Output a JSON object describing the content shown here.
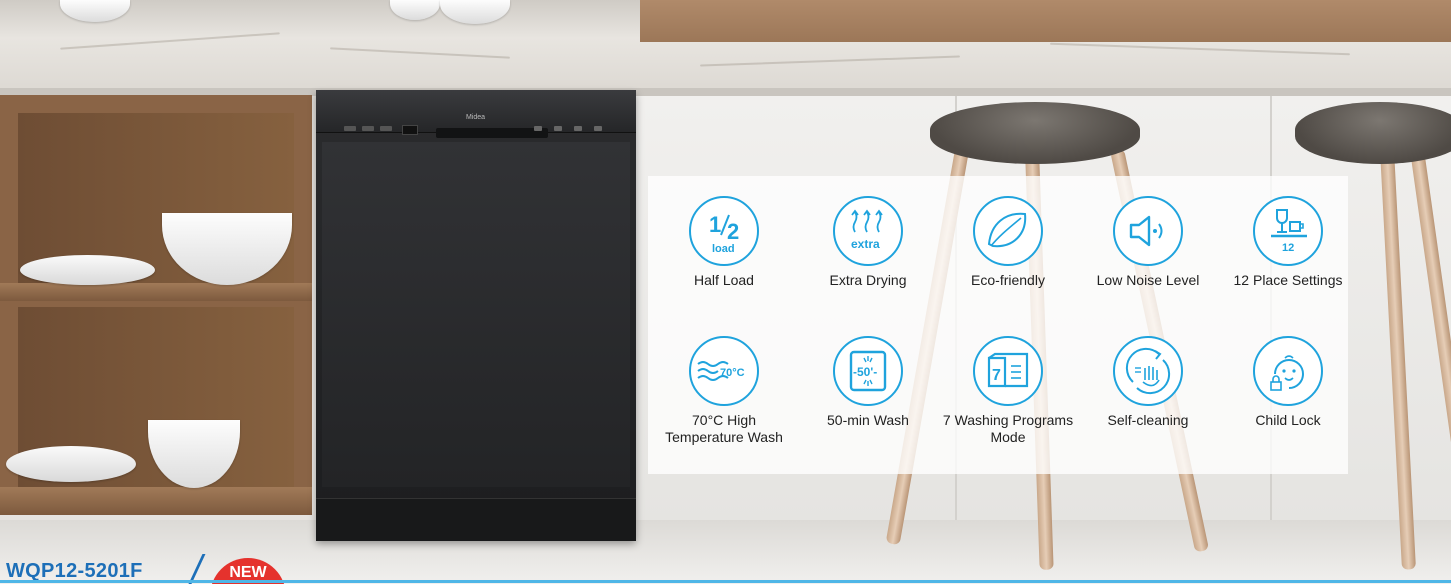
{
  "brand_logo": "Midea",
  "model": {
    "name": "WQP12-5201F",
    "badge": "NEW"
  },
  "colors": {
    "accent": "#1fa3dd",
    "model_text": "#1d6fb8",
    "badge": "#e5322d",
    "bottom_line": "#4fb6e7"
  },
  "features": [
    {
      "label": "Half Load",
      "icon": "half-load-icon",
      "icon_text_top": "1/2",
      "icon_text_bottom": "load"
    },
    {
      "label": "Extra Drying",
      "icon": "extra-drying-icon",
      "icon_text_bottom": "extra"
    },
    {
      "label": "Eco-friendly",
      "icon": "eco-leaf-icon"
    },
    {
      "label": "Low Noise Level",
      "icon": "speaker-icon"
    },
    {
      "label": "12 Place Settings",
      "icon": "place-settings-icon",
      "icon_text_bottom": "12"
    },
    {
      "label": "70°C High Temperature Wash",
      "icon": "high-temperature-icon",
      "icon_text": "70°C"
    },
    {
      "label": "50-min Wash",
      "icon": "timer-wash-icon",
      "icon_text": "-50'-"
    },
    {
      "label": "7 Washing Programs Mode",
      "icon": "programs-icon",
      "icon_text": "7"
    },
    {
      "label": "Self-cleaning",
      "icon": "self-cleaning-icon"
    },
    {
      "label": "Child Lock",
      "icon": "child-lock-icon"
    }
  ]
}
